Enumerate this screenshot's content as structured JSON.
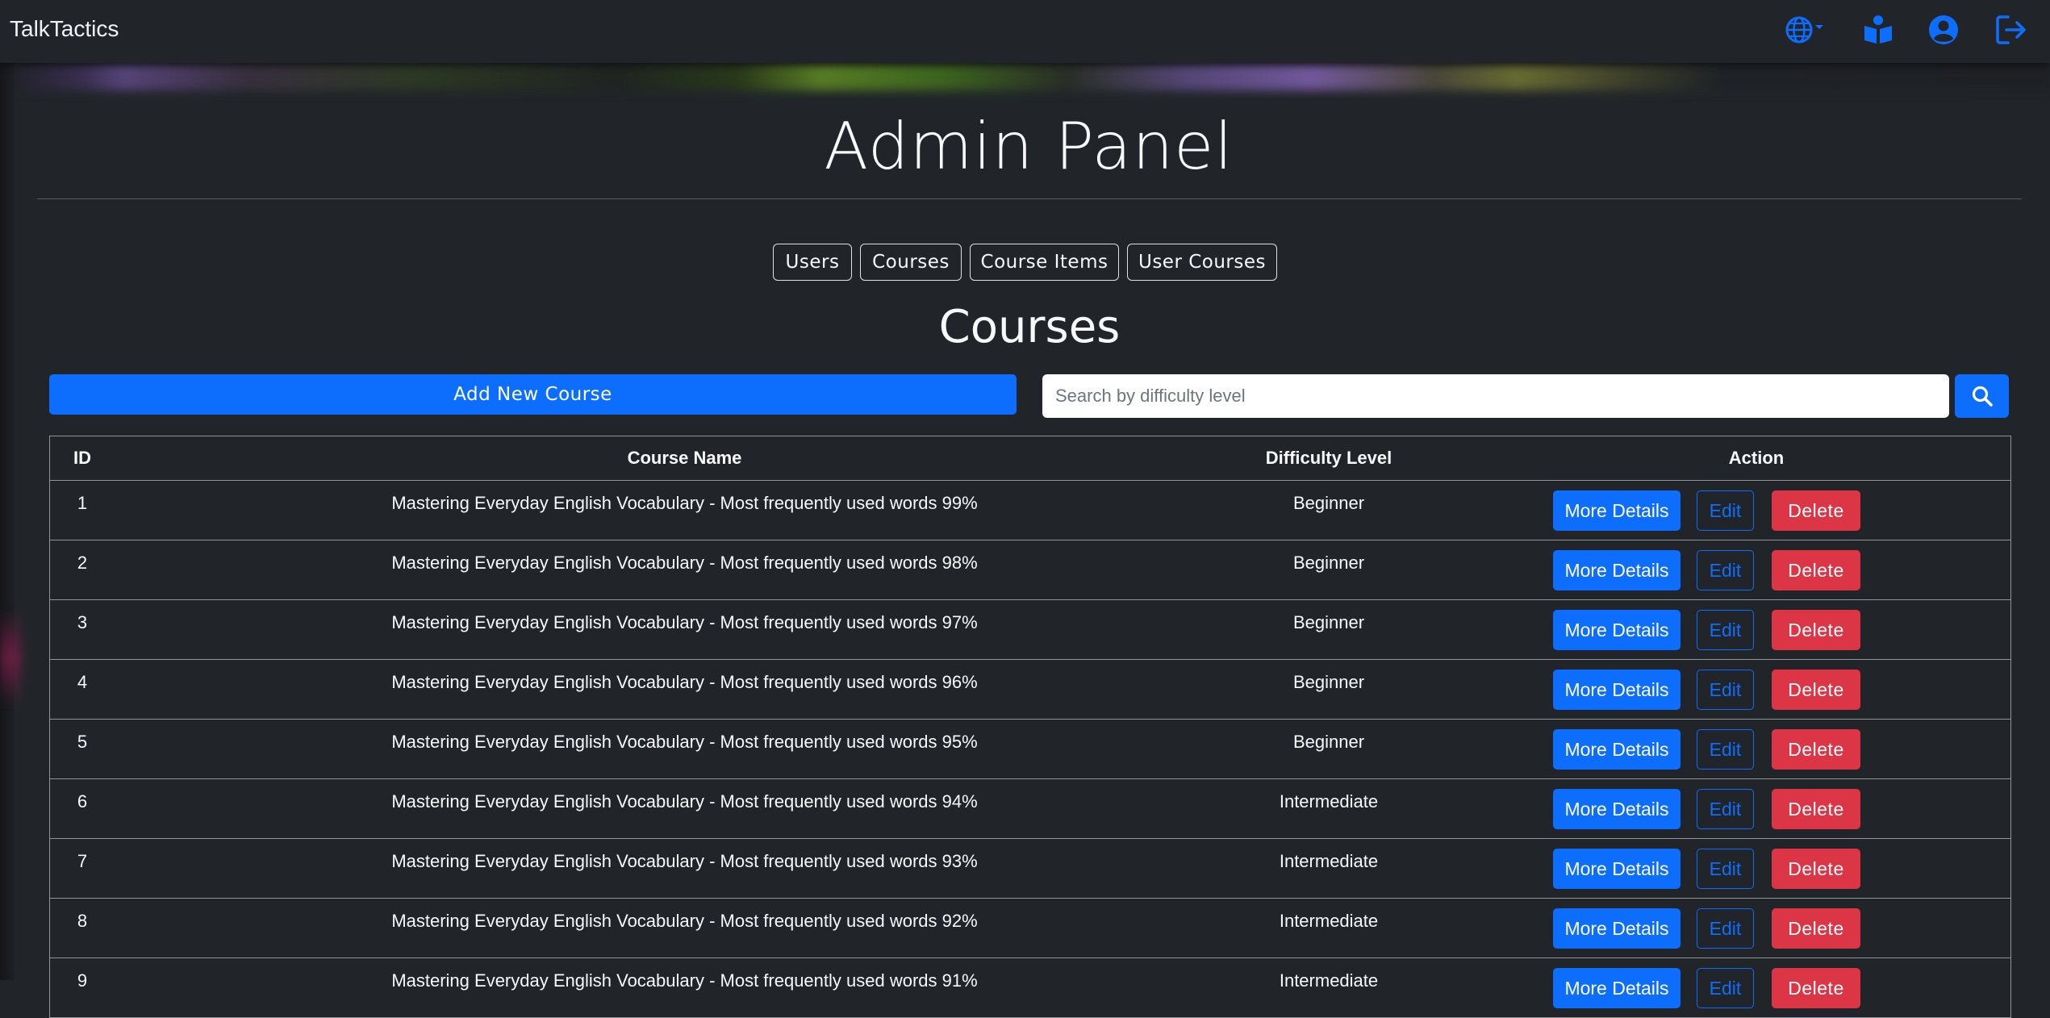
{
  "navbar": {
    "brand": "TalkTactics",
    "icons": [
      "globe-icon",
      "book-reader-icon",
      "user-circle-icon",
      "logout-icon"
    ],
    "accent_color": "#0d6efd"
  },
  "page": {
    "title": "Admin Panel",
    "tabs": [
      {
        "label": "Users"
      },
      {
        "label": "Courses"
      },
      {
        "label": "Course Items"
      },
      {
        "label": "User Courses"
      }
    ],
    "section_title": "Courses",
    "add_button_label": "Add New Course",
    "search": {
      "placeholder": "Search by difficulty level",
      "value": ""
    }
  },
  "table": {
    "headers": {
      "id": "ID",
      "name": "Course Name",
      "difficulty": "Difficulty Level",
      "action": "Action"
    },
    "action_labels": {
      "more": "More Details",
      "edit": "Edit",
      "delete": "Delete"
    },
    "rows": [
      {
        "id": "1",
        "name": "Mastering Everyday English Vocabulary - Most frequently used words 99%",
        "difficulty": "Beginner"
      },
      {
        "id": "2",
        "name": "Mastering Everyday English Vocabulary - Most frequently used words 98%",
        "difficulty": "Beginner"
      },
      {
        "id": "3",
        "name": "Mastering Everyday English Vocabulary - Most frequently used words 97%",
        "difficulty": "Beginner"
      },
      {
        "id": "4",
        "name": "Mastering Everyday English Vocabulary - Most frequently used words 96%",
        "difficulty": "Beginner"
      },
      {
        "id": "5",
        "name": "Mastering Everyday English Vocabulary - Most frequently used words 95%",
        "difficulty": "Beginner"
      },
      {
        "id": "6",
        "name": "Mastering Everyday English Vocabulary - Most frequently used words 94%",
        "difficulty": "Intermediate"
      },
      {
        "id": "7",
        "name": "Mastering Everyday English Vocabulary - Most frequently used words 93%",
        "difficulty": "Intermediate"
      },
      {
        "id": "8",
        "name": "Mastering Everyday English Vocabulary - Most frequently used words 92%",
        "difficulty": "Intermediate"
      },
      {
        "id": "9",
        "name": "Mastering Everyday English Vocabulary - Most frequently used words 91%",
        "difficulty": "Intermediate"
      }
    ]
  },
  "colors": {
    "background": "#212529",
    "primary": "#0d6efd",
    "danger": "#dc3545"
  }
}
